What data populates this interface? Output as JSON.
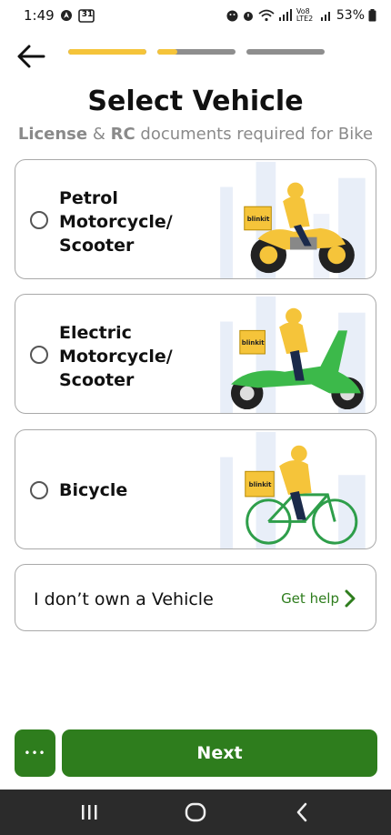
{
  "status_bar": {
    "time": "1:49",
    "calendar_day": "31",
    "battery": "53%",
    "network": "Vo8 LTE2"
  },
  "header": {
    "progress": [
      1.0,
      0.25,
      0.0
    ]
  },
  "page": {
    "title": "Select Vehicle",
    "subtitle_part1": "License",
    "subtitle_part2": " & ",
    "subtitle_part3": "RC",
    "subtitle_part4": " documents required for Bike"
  },
  "options": [
    {
      "line1": "Petrol",
      "line2": "Motorcycle/",
      "line3": "Scooter"
    },
    {
      "line1": "Electric",
      "line2": "Motorcycle/",
      "line3": "Scooter"
    },
    {
      "line1": "Bicycle"
    }
  ],
  "brand": {
    "box_text": "blinkit"
  },
  "no_vehicle": {
    "label": "I don’t own a Vehicle",
    "help": "Get help"
  },
  "footer": {
    "more": "•••",
    "next": "Next"
  },
  "colors": {
    "accent_yellow": "#f5c43a",
    "brand_green": "#2e7d1d"
  },
  "icons": {
    "back": "arrow-left-icon",
    "help": "chevron-right-icon",
    "nav": [
      "recent-apps-icon",
      "home-icon",
      "back-icon"
    ]
  }
}
